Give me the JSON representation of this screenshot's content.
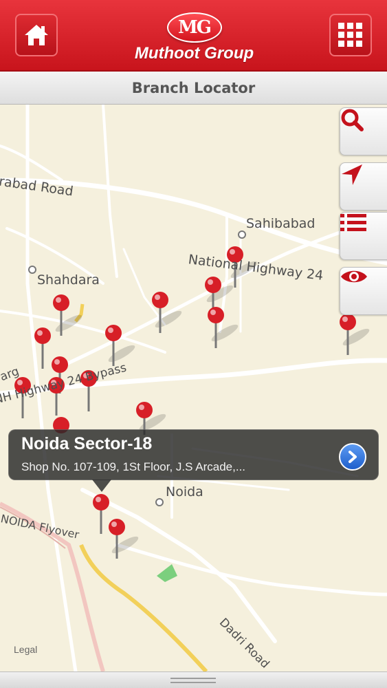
{
  "header": {
    "brand": "Muthoot Group",
    "logo_mark": "MG",
    "home_icon": "home-icon",
    "menu_icon": "grid-menu-icon",
    "accent": "#d71f27"
  },
  "subtitle": "Branch Locator",
  "map": {
    "labels": {
      "road1": "rabad Road",
      "sahibabad": "Sahibabad",
      "nh24": "National Highway 24",
      "shahdara": "Shahdara",
      "bypass": "NH Highway 24 Bypass",
      "marg": "arg",
      "noida": "Noida",
      "flyover": "NOIDA Flyover",
      "dadri": "Dadri Road",
      "legal": "Legal"
    },
    "side_buttons": [
      "search-icon",
      "locate-arrow-icon",
      "list-icon",
      "eye-icon"
    ]
  },
  "callout": {
    "title": "Noida Sector-18",
    "address": "Shop No. 107-109,  1St Floor,  J.S Arcade,..."
  }
}
